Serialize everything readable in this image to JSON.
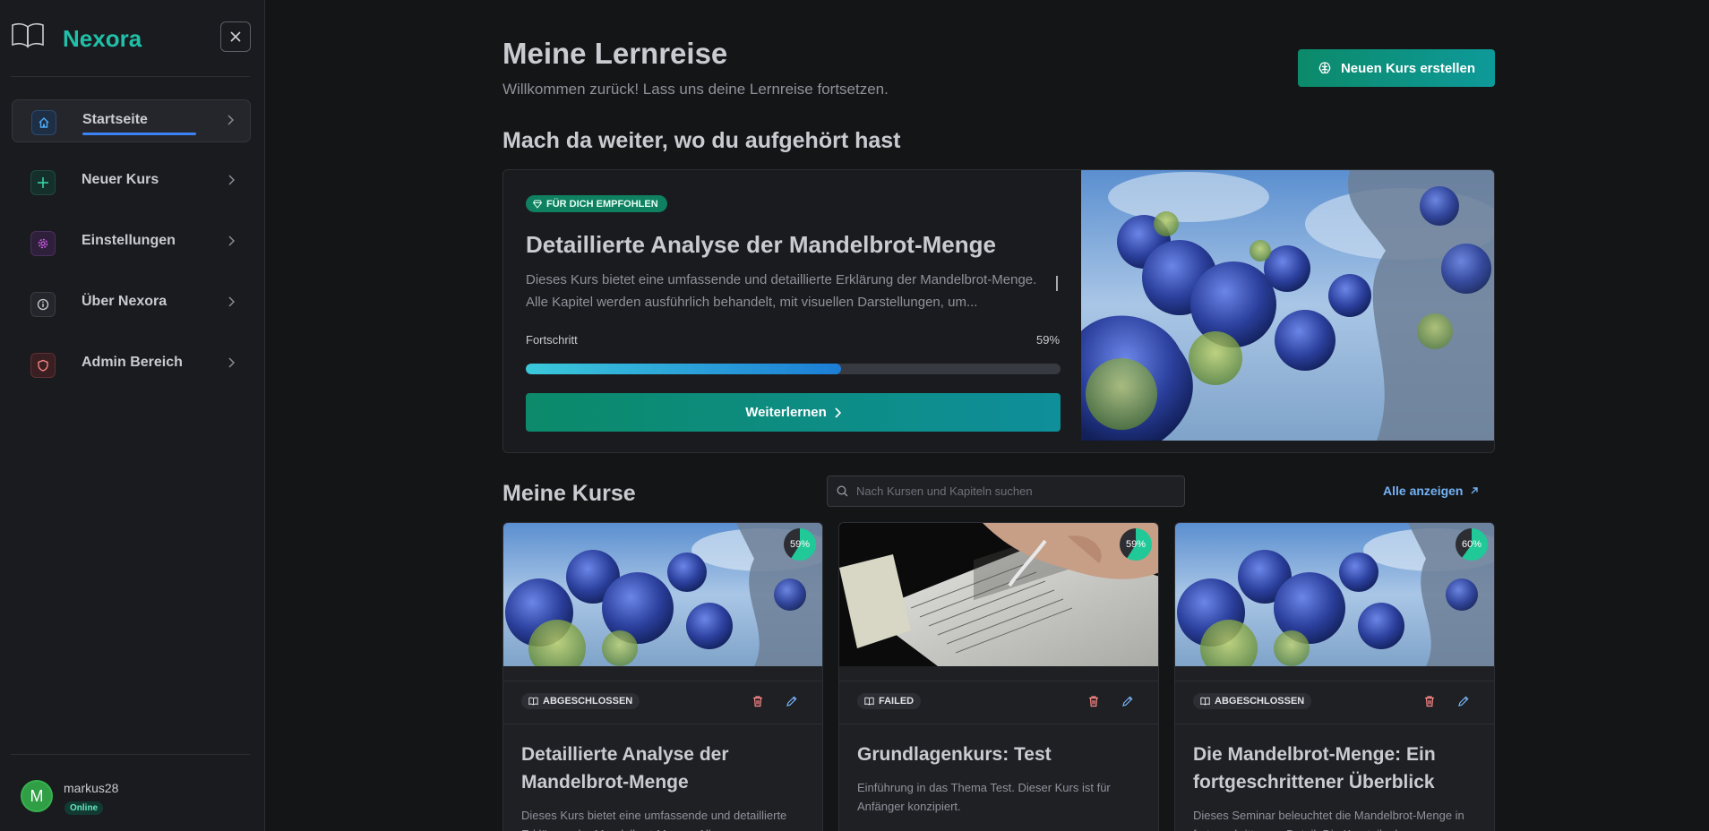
{
  "app": {
    "name": "Nexora"
  },
  "sidebar": {
    "items": [
      {
        "label": "Startseite",
        "icon": "home-icon",
        "color": "#4dabf7"
      },
      {
        "label": "Neuer Kurs",
        "icon": "plus-icon",
        "color": "#38d9a9"
      },
      {
        "label": "Einstellungen",
        "icon": "gear-icon",
        "color": "#cc5de8"
      },
      {
        "label": "Über Nexora",
        "icon": "info-icon",
        "color": "#c9cbd0"
      },
      {
        "label": "Admin Bereich",
        "icon": "shield-icon",
        "color": "#ff8787"
      }
    ],
    "user": {
      "initial": "M",
      "name": "markus28",
      "status": "Online"
    }
  },
  "header": {
    "title": "Meine Lernreise",
    "subtitle": "Willkommen zurück! Lass uns deine Lernreise fortsetzen.",
    "new_course_label": "Neuen Kurs erstellen"
  },
  "continue_section": {
    "title": "Mach da weiter, wo du aufgehört hast",
    "badge": "FÜR DICH EMPFOHLEN",
    "course_title": "Detaillierte Analyse der Mandelbrot-Menge",
    "description": "Dieses Kurs bietet eine umfassende und detaillierte Erklärung der Mandelbrot-Menge. Alle Kapitel werden ausführlich behandelt, mit visuellen Darstellungen, um...",
    "progress_label": "Fortschritt",
    "progress_text": "59%",
    "progress": 0.59,
    "button_label": "Weiterlernen"
  },
  "courses_section": {
    "title": "Meine Kurse",
    "search_placeholder": "Nach Kursen und Kapiteln suchen",
    "all_link": "Alle anzeigen",
    "cards": [
      {
        "progress_text": "59%",
        "progress": 0.59,
        "status": "ABGESCHLOSSEN",
        "title": "Detaillierte Analyse der Mandelbrot-Menge",
        "description": "Dieses Kurs bietet eine umfassende und detaillierte Erklärung der Mandelbrot-Menge. Alle",
        "image": "fractal"
      },
      {
        "progress_text": "59%",
        "progress": 0.59,
        "status": "FAILED",
        "title": "Grundlagenkurs: Test",
        "description": "Einführung in das Thema Test. Dieser Kurs ist für Anfänger konzipiert.",
        "image": "exam"
      },
      {
        "progress_text": "60%",
        "progress": 0.6,
        "status": "ABGESCHLOSSEN",
        "title": "Die Mandelbrot-Menge: Ein fortgeschrittener Überblick",
        "description": "Dieses Seminar beleuchtet die Mandelbrot-Menge in fortgeschrittenem Detail. Die Kursteilnehmer",
        "image": "fractal"
      }
    ]
  },
  "colors": {
    "accent": "#20c0a8",
    "link": "#74b2f5",
    "progress": "#3bc9db"
  }
}
